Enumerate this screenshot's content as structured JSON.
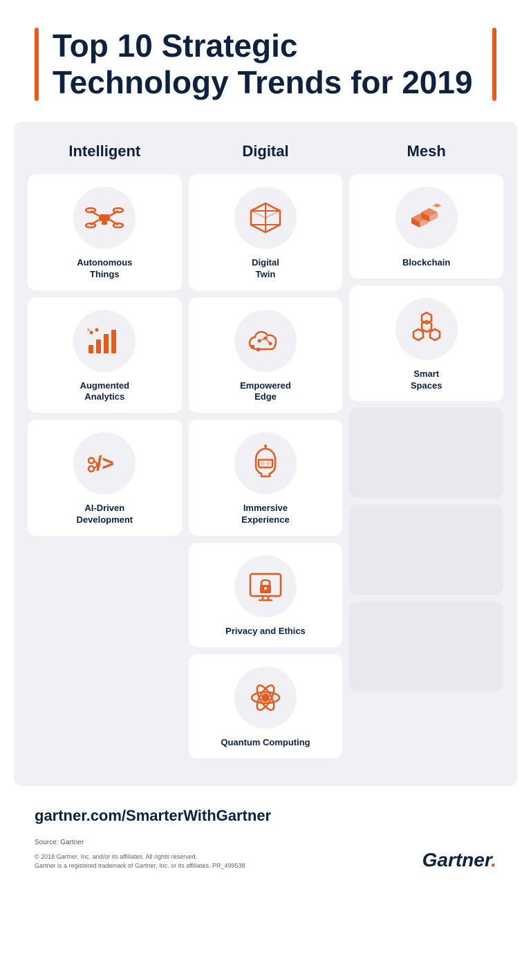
{
  "header": {
    "title": "Top 10 Strategic Technology Trends for 2019"
  },
  "columns": [
    {
      "label": "Intelligent",
      "items": [
        {
          "name": "Autonomous Things",
          "icon": "drone"
        },
        {
          "name": "Augmented Analytics",
          "icon": "analytics"
        },
        {
          "name": "AI-Driven Development",
          "icon": "ai-dev"
        }
      ]
    },
    {
      "label": "Digital",
      "items": [
        {
          "name": "Digital Twin",
          "icon": "digital-twin"
        },
        {
          "name": "Empowered Edge",
          "icon": "edge"
        },
        {
          "name": "Immersive Experience",
          "icon": "immersive"
        },
        {
          "name": "Privacy and Ethics",
          "icon": "privacy"
        },
        {
          "name": "Quantum Computing",
          "icon": "quantum"
        }
      ]
    },
    {
      "label": "Mesh",
      "items": [
        {
          "name": "Blockchain",
          "icon": "blockchain"
        },
        {
          "name": "Smart Spaces",
          "icon": "smart-spaces"
        }
      ]
    }
  ],
  "footer": {
    "website": "gartner.com/SmarterWithGartner",
    "source": "Source: Gartner",
    "copyright": "© 2018 Gartner, Inc. and/or its affiliates. All rights reserved.\nGartner is a registered trademark of Gartner, Inc. or its affiliates. PR_499538",
    "logo": "Gartner."
  }
}
